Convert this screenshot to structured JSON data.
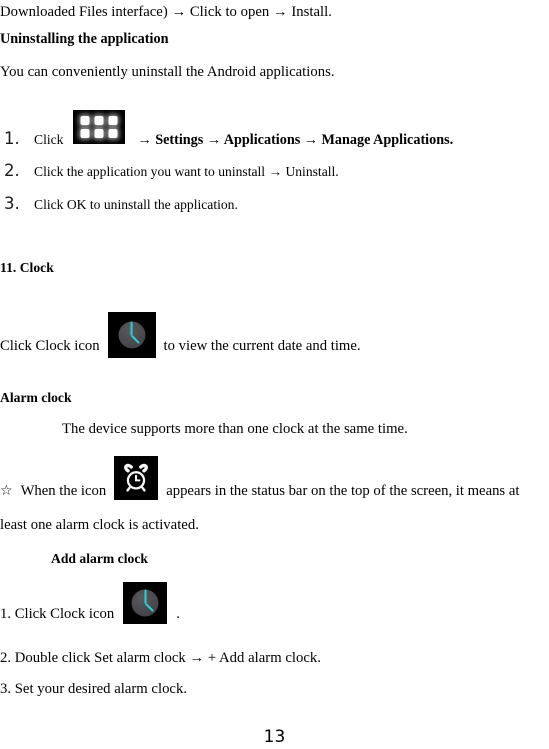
{
  "document": {
    "page_number": "13"
  },
  "lines": {
    "continued_install": "Downloaded Files interface) → Click to open → Install.",
    "uninstall_heading": "Uninstalling the application",
    "uninstall_intro": "You can conveniently uninstall the Android applications.",
    "clock_heading": "11. Clock",
    "alarm_heading": "Alarm clock",
    "alarm_intro": "The device supports more than one clock at the same time.",
    "add_alarm_heading": "Add alarm clock"
  },
  "uninstall_steps": [
    {
      "number": "1.",
      "before_icon": "Click",
      "icon": "apps-grid-icon",
      "after_icon": "→ Settings → Applications → Manage Applications.",
      "after_icon_bold": true
    },
    {
      "number": "2.",
      "text": "Click the application you want to uninstall → Uninstall."
    },
    {
      "number": "3.",
      "text": "Click OK to uninstall the application."
    }
  ],
  "clock_section": {
    "click_clock_before": "Click Clock icon",
    "click_clock_icon": "clock-icon",
    "click_clock_after": "to view the current date and time."
  },
  "alarm_section": {
    "bullet": "☆",
    "before_icon": "When the icon",
    "icon": "alarm-clock-icon",
    "after_icon": "appears in the status bar on the top of the screen, it means at",
    "wrapped_line": "least one alarm clock is activated."
  },
  "add_alarm_steps": [
    {
      "prefix": "1. Click Clock icon",
      "icon": "clock-icon",
      "suffix": "."
    },
    {
      "text": "2. Double click Set alarm clock → + Add alarm clock."
    },
    {
      "text": "3. Set your desired alarm clock."
    }
  ],
  "colors": {
    "icon_background": "#000000",
    "clock_hands": "#27d3d3",
    "clock_bezel": "#d8d8d8",
    "clock_face": "#4a4a4e",
    "text": "#000000"
  }
}
